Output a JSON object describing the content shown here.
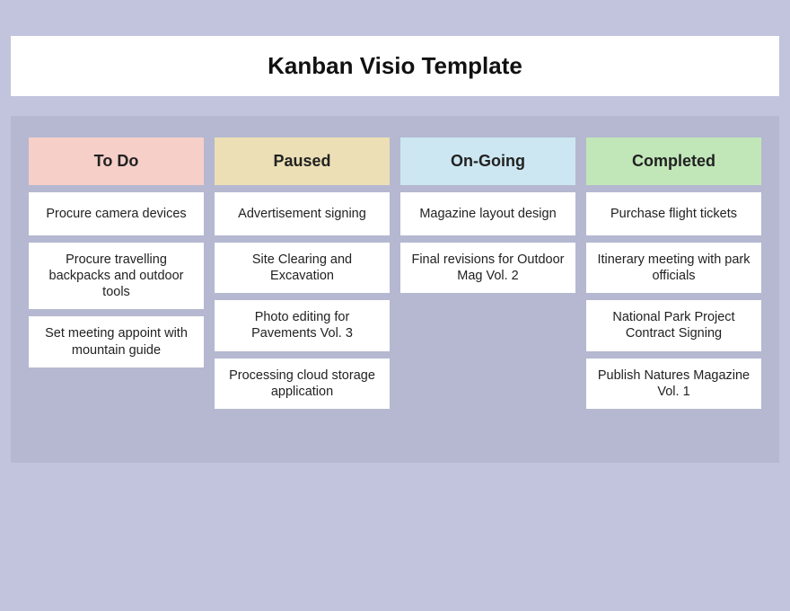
{
  "title": "Kanban Visio Template",
  "columns": [
    {
      "key": "todo",
      "label": "To Do",
      "cards": [
        "Procure camera devices",
        "Procure travelling backpacks and outdoor tools",
        "Set meeting appoint with mountain guide"
      ]
    },
    {
      "key": "paused",
      "label": "Paused",
      "cards": [
        "Advertisement signing",
        "Site Clearing and Excavation",
        "Photo editing for Pavements Vol. 3",
        "Processing cloud storage application"
      ]
    },
    {
      "key": "ongoing",
      "label": "On-Going",
      "cards": [
        "Magazine layout design",
        "Final revisions for Outdoor Mag Vol. 2"
      ]
    },
    {
      "key": "completed",
      "label": "Completed",
      "cards": [
        "Purchase flight tickets",
        "Itinerary meeting with park officials",
        "National Park Project Contract Signing",
        "Publish Natures Magazine Vol. 1"
      ]
    }
  ]
}
